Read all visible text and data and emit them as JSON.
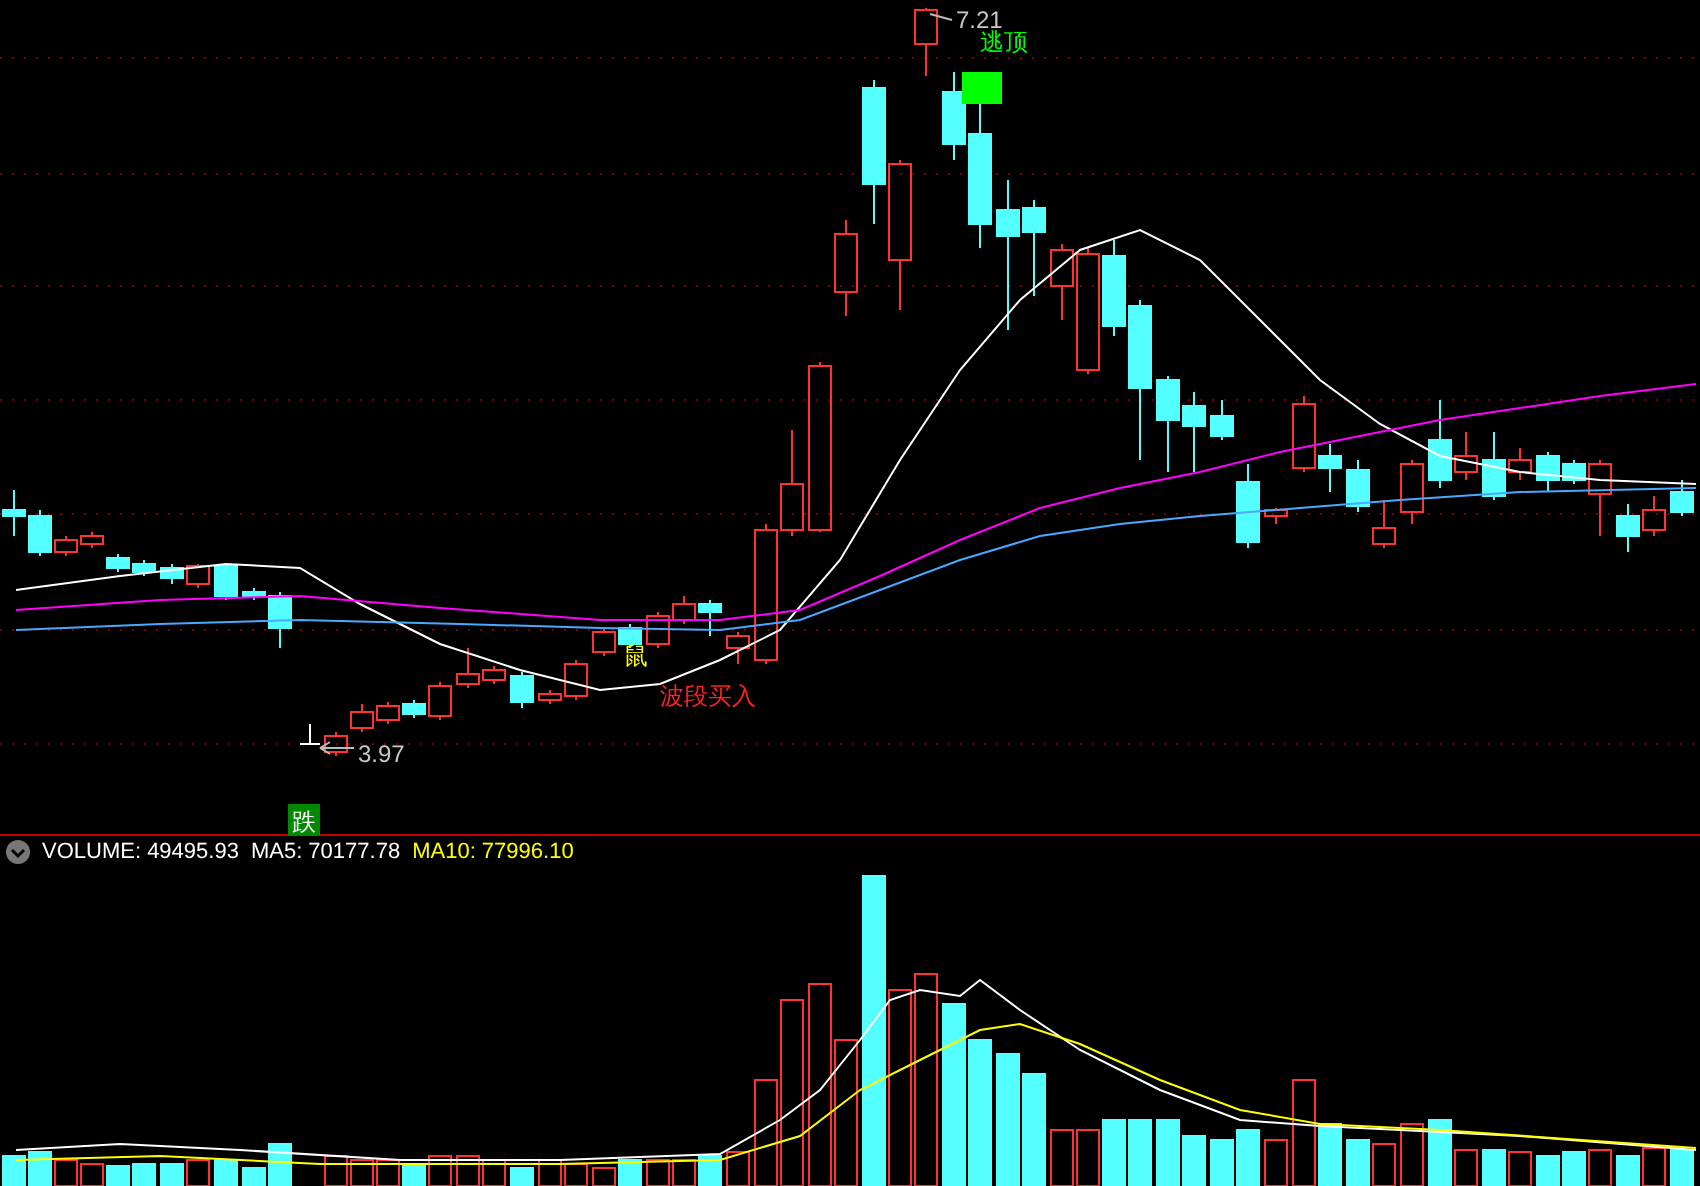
{
  "main_chart": {
    "high_label": "7.21",
    "low_label": "3.97",
    "signals": [
      {
        "kind": "escape_top",
        "text": "逃顶"
      },
      {
        "kind": "marker",
        "text": "鼠"
      },
      {
        "kind": "buy",
        "text": "波段买入"
      },
      {
        "kind": "fall",
        "text": "跌"
      }
    ]
  },
  "volume_panel": {
    "readings": [
      {
        "text": "VOLUME: 49495.93",
        "color": "#ffffff"
      },
      {
        "text": "MA5: 70177.78",
        "color": "#ffffff"
      },
      {
        "text": "MA10: 77996.10",
        "color": "#ffff00"
      }
    ]
  }
}
